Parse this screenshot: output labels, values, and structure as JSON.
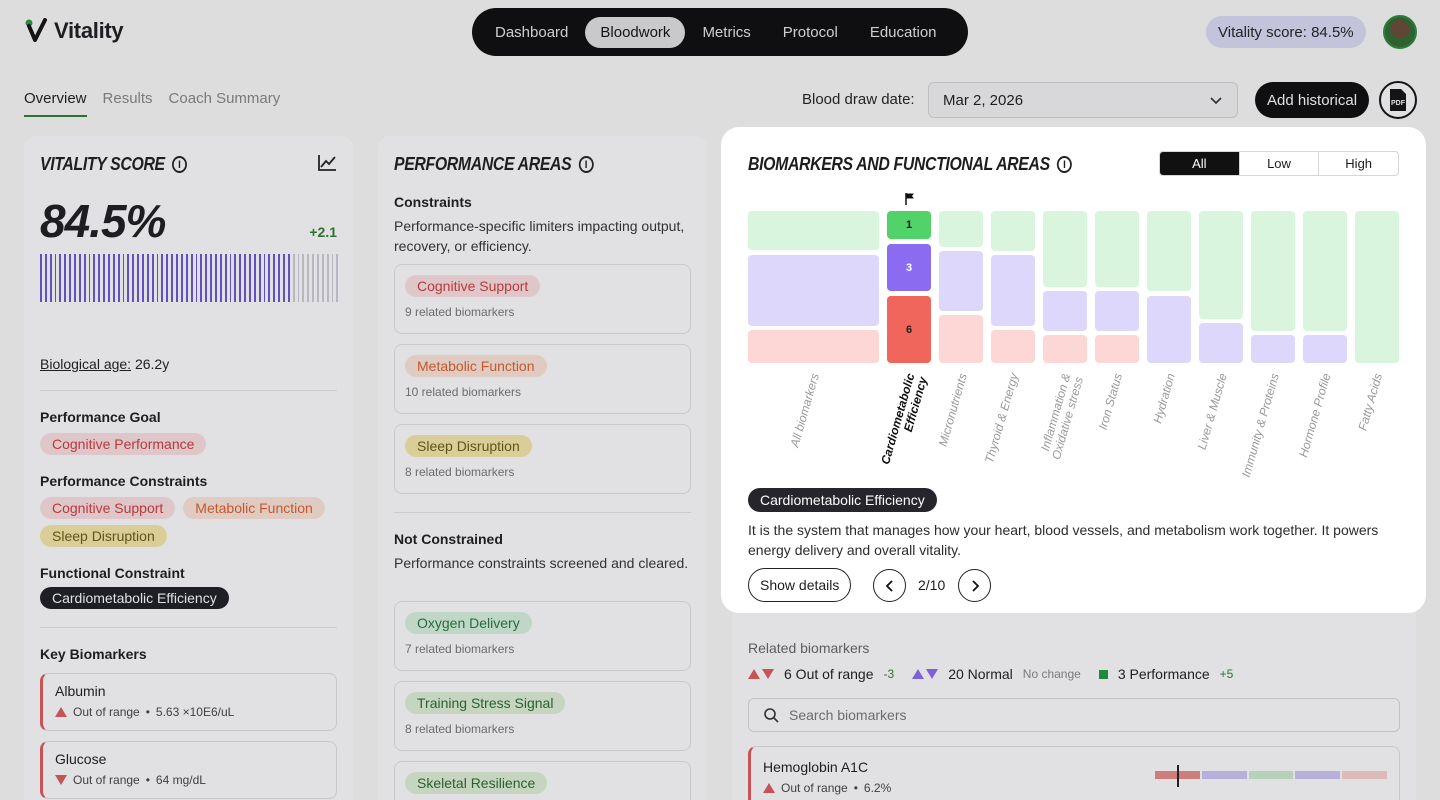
{
  "app": {
    "name": "Vitality"
  },
  "nav": {
    "items": [
      "Dashboard",
      "Bloodwork",
      "Metrics",
      "Protocol",
      "Education"
    ],
    "active": "Bloodwork"
  },
  "header": {
    "score_pill": "Vitality score: 84.5%"
  },
  "subtabs": {
    "items": [
      "Overview",
      "Results",
      "Coach Summary"
    ],
    "active": "Overview"
  },
  "toolbar": {
    "draw_label": "Blood draw date:",
    "draw_date": "Mar 2, 2026",
    "add_historical": "Add historical",
    "pdf_label": "PDF"
  },
  "vitality": {
    "title": "Vitality Score",
    "score": "84.5%",
    "delta": "+2.1",
    "bio_age_label": "Biological age:",
    "bio_age_value": "26.2y",
    "bars_filled_fraction": 0.845,
    "goal_heading": "Performance Goal",
    "goal": "Cognitive Performance",
    "constraints_heading": "Performance Constraints",
    "constraints": [
      "Cognitive Support",
      "Metabolic Function",
      "Sleep Disruption"
    ],
    "functional_heading": "Functional Constraint",
    "functional": "Cardiometabolic Efficiency",
    "key_heading": "Key Biomarkers",
    "key_biomarkers": [
      {
        "name": "Albumin",
        "status": "Out of range",
        "value": "5.63 ×10E6/uL",
        "direction": "up"
      },
      {
        "name": "Glucose",
        "status": "Out of range",
        "value": "64 mg/dL",
        "direction": "down"
      }
    ]
  },
  "performance": {
    "title": "Performance Areas",
    "constraints_heading": "Constraints",
    "constraints_desc": "Performance-specific limiters impacting output, recovery, or efficiency.",
    "constraints": [
      {
        "name": "Cognitive Support",
        "count": "9 related biomarkers",
        "tone": "red"
      },
      {
        "name": "Metabolic Function",
        "count": "10 related biomarkers",
        "tone": "orange"
      },
      {
        "name": "Sleep Disruption",
        "count": "8 related biomarkers",
        "tone": "yellow"
      }
    ],
    "not_heading": "Not Constrained",
    "not_desc": "Performance constraints screened and cleared.",
    "not_constrained": [
      {
        "name": "Oxygen Delivery",
        "count": "7 related biomarkers"
      },
      {
        "name": "Training Stress Signal",
        "count": "8 related biomarkers"
      },
      {
        "name": "Skeletal Resilience",
        "count": ""
      }
    ]
  },
  "related": {
    "heading": "Related biomarkers",
    "out_label": "6 Out of range",
    "out_delta": "-3",
    "normal_label": "20 Normal",
    "normal_delta": "No change",
    "perf_label": "3 Performance",
    "perf_delta": "+5",
    "search_placeholder": "Search biomarkers",
    "row": {
      "name": "Hemoglobin A1C",
      "status": "Out of range",
      "value": "6.2%"
    }
  },
  "biomarkers_card": {
    "title": "Biomarkers and Functional Areas",
    "filters": [
      "All",
      "Low",
      "High"
    ],
    "active_filter": "All",
    "selected": "Cardiometabolic Efficiency",
    "selected_counts": {
      "high": "1",
      "normal": "3",
      "low": "6"
    },
    "columns": [
      "All biomarkers",
      "Cardiometabolic Efficiency",
      "Micronutrients",
      "Thyroid & Energy",
      "Inflammation & Oxidative stress",
      "Iron Status",
      "Hydration",
      "Liver & Muscle",
      "Immunity & Proteins",
      "Hormone Profile",
      "Fatty Acids"
    ],
    "description": "It is the system that manages how your heart, blood vessels, and metabolism work together. It powers energy delivery and overall vitality.",
    "show_details": "Show details",
    "pager": "2/10"
  },
  "colors": {
    "accent_purple": "#6e55d6",
    "green": "#2e7d32",
    "red": "#e05a5a",
    "dark": "#0b0b0c"
  }
}
